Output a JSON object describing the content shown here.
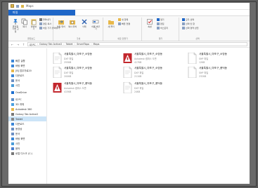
{
  "window": {
    "title": "Maps"
  },
  "tabs": [
    "파일",
    "홈",
    "공유",
    "보기"
  ],
  "ribbon": {
    "clipboard": {
      "label": "클립보드",
      "pin_label": "즐겨찾기에 고정",
      "copy_label": "복사",
      "paste_label": "붙여넣기",
      "cut_label": "잘라내기",
      "copy_path_label": "경로 복사",
      "paste_shortcut_label": "바로 가기 붙여넣기"
    },
    "organize": {
      "label": "구성",
      "move_label": "이동 위치",
      "copy_to_label": "복사 위치",
      "delete_label": "삭제",
      "rename_label": "이름 바꾸기"
    },
    "new": {
      "label": "새로 만들기",
      "new_folder_label": "새 폴더",
      "new_item_label": "새 항목",
      "easy_access_label": "빠른 연결"
    },
    "open": {
      "label": "열기",
      "properties_label": "속성",
      "open_label": "열기",
      "edit_label": "편집",
      "history_label": "히스토리"
    },
    "select": {
      "label": "선택",
      "select_all_label": "모두 선택",
      "select_none_label": "선택 안 함",
      "invert_label": "선택 영역 반전"
    }
  },
  "address": {
    "crumbs": [
      "내 PC",
      "Galaxy Tab Active2",
      "Tablet",
      "SmartTopo",
      "Maps"
    ]
  },
  "navpane": {
    "items": [
      {
        "label": "빠른 실행",
        "icon": "star-icon",
        "color": "#3a86d8"
      },
      {
        "label": "바탕 화면",
        "icon": "desktop-icon",
        "color": "#3a86d8"
      },
      {
        "label": "[B] 업무자료20",
        "icon": "folder-icon",
        "color": "#e8b84a"
      },
      {
        "label": "다운로드",
        "icon": "download-icon",
        "color": "#3a86d8"
      },
      {
        "label": "문서",
        "icon": "document-icon",
        "color": "#6b8fc4"
      },
      {
        "label": "사진",
        "icon": "picture-icon",
        "color": "#4a9cd8"
      },
      {
        "label": "OneDrive",
        "icon": "cloud-icon",
        "color": "#1e6fd0",
        "gap": true
      },
      {
        "label": "내 PC",
        "icon": "computer-icon",
        "color": "#5b8dc9",
        "gap": true
      },
      {
        "label": "3D 개체",
        "icon": "cube-icon",
        "color": "#4aa0e0"
      },
      {
        "label": "Autodesk 360",
        "icon": "folder-icon",
        "color": "#e8b84a"
      },
      {
        "label": "Galaxy Tab Active2",
        "icon": "tablet-icon",
        "color": "#777777"
      },
      {
        "label": "Tablet",
        "icon": "drive-icon",
        "color": "#888888",
        "selected": true
      },
      {
        "label": "다운로드",
        "icon": "download-icon",
        "color": "#3a86d8"
      },
      {
        "label": "동영상",
        "icon": "video-icon",
        "color": "#6b8fc4"
      },
      {
        "label": "문서",
        "icon": "document-icon",
        "color": "#6b8fc4"
      },
      {
        "label": "바탕 화면",
        "icon": "desktop-icon",
        "color": "#3a86d8"
      },
      {
        "label": "사진",
        "icon": "picture-icon",
        "color": "#4a9cd8"
      },
      {
        "label": "음악",
        "icon": "music-icon",
        "color": "#4a7ed0"
      },
      {
        "label": "로컬 디스크 (C:)",
        "icon": "drive-icon",
        "color": "#777777"
      }
    ]
  },
  "files": [
    {
      "name": "서울특별시_마포구_소망동",
      "type": "DXF 파일",
      "size": "255KB",
      "kind": "dxf"
    },
    {
      "name": "서울특별시_마포구_소망동",
      "type": "Autodesk 캠퍼스 도면",
      "size": "417KB",
      "kind": "dwg"
    },
    {
      "name": "서울특별시_마포구_소망동",
      "type": "SHP 파일",
      "size": "12KB",
      "kind": "shp"
    },
    {
      "name": "서울특별시_마포구_소망동",
      "type": "DXF 파일",
      "size": "200KB",
      "kind": "dxf"
    },
    {
      "name": "서울특별시_마포구_소망동",
      "type": "DXF 파일",
      "size": "211KB",
      "kind": "dxf"
    },
    {
      "name": "서울특별시_마포구_풍덕동",
      "type": "SHP 파일",
      "size": "232KB",
      "kind": "shp"
    },
    {
      "name": "서울특별시_마포구_풍덕동",
      "type": "Autodesk 캠퍼스 도면",
      "size": "415KB",
      "kind": "dwg"
    },
    {
      "name": "서울특별시_마포구_풍덕동",
      "type": "DXF 파일",
      "size": "24KB",
      "kind": "dxf"
    }
  ]
}
